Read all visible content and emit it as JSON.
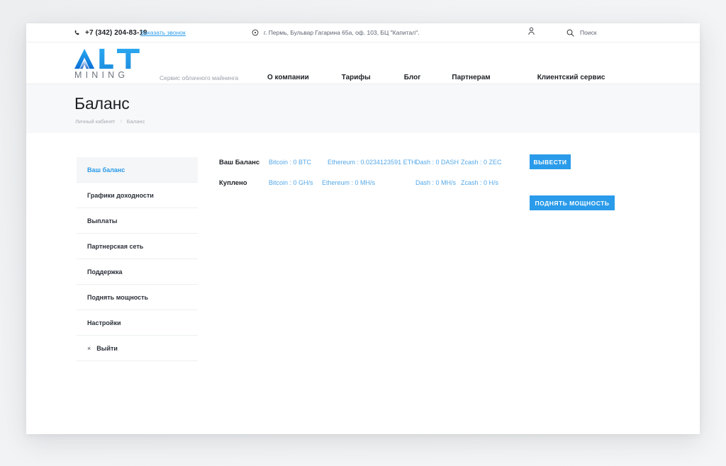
{
  "topbar": {
    "phone_icon": "phone-icon",
    "phone": "+7 (342) 204-83-19",
    "callback_link": "Заказать звонок",
    "location_icon": "location-pin-icon",
    "address": "г. Пермь, Бульвар Гагарина 65а, оф. 103, БЦ \"Капитал\".",
    "user_icon": "user-account-icon",
    "search_icon": "search-icon",
    "search_label": "Поиск"
  },
  "header": {
    "logo_main": "ALT",
    "logo_sub": "MINING",
    "tagline": "Сервис облачного майнинга",
    "nav": [
      {
        "label": "О компании"
      },
      {
        "label": "Тарифы"
      },
      {
        "label": "Блог"
      },
      {
        "label": "Партнерам"
      },
      {
        "label": "Клиентский сервис"
      }
    ]
  },
  "title_band": {
    "title": "Баланс",
    "breadcrumb": [
      {
        "label": "Личный кабинет"
      },
      {
        "label": "Баланс"
      }
    ],
    "separator": "›"
  },
  "sidebar": {
    "items": [
      {
        "label": "Ваш баланс",
        "active": true
      },
      {
        "label": "Графики доходности",
        "active": false
      },
      {
        "label": "Выплаты",
        "active": false
      },
      {
        "label": "Партнерская сеть",
        "active": false
      },
      {
        "label": "Поддержка",
        "active": false
      },
      {
        "label": "Поднять мощность",
        "active": false
      },
      {
        "label": "Настройки",
        "active": false
      },
      {
        "label": "Выйти",
        "active": false,
        "icon": "close-x-icon",
        "icon_glyph": "×"
      }
    ]
  },
  "balance": {
    "rows": [
      {
        "label": "Ваш Баланс",
        "coins": [
          "Bitcoin : 0 BTC",
          "Ethereum : 0.0234123591 ETH",
          "Dash : 0 DASH",
          "Zcash : 0 ZEC"
        ]
      },
      {
        "label": "Куплено",
        "coins": [
          "Bitcoin : 0 GH/s",
          "Ethereum : 0 MH/s",
          "Dash : 0 MH/s",
          "Zcash : 0 H/s"
        ]
      }
    ],
    "withdraw_button": "ВЫВЕСТИ",
    "power_button": "ПОДНЯТЬ МОЩНОСТЬ"
  },
  "colors": {
    "accent": "#2a9bea",
    "link": "#55a8e8",
    "text": "#1d2026",
    "muted": "#9aa0aa",
    "band": "#f7f8f9"
  }
}
